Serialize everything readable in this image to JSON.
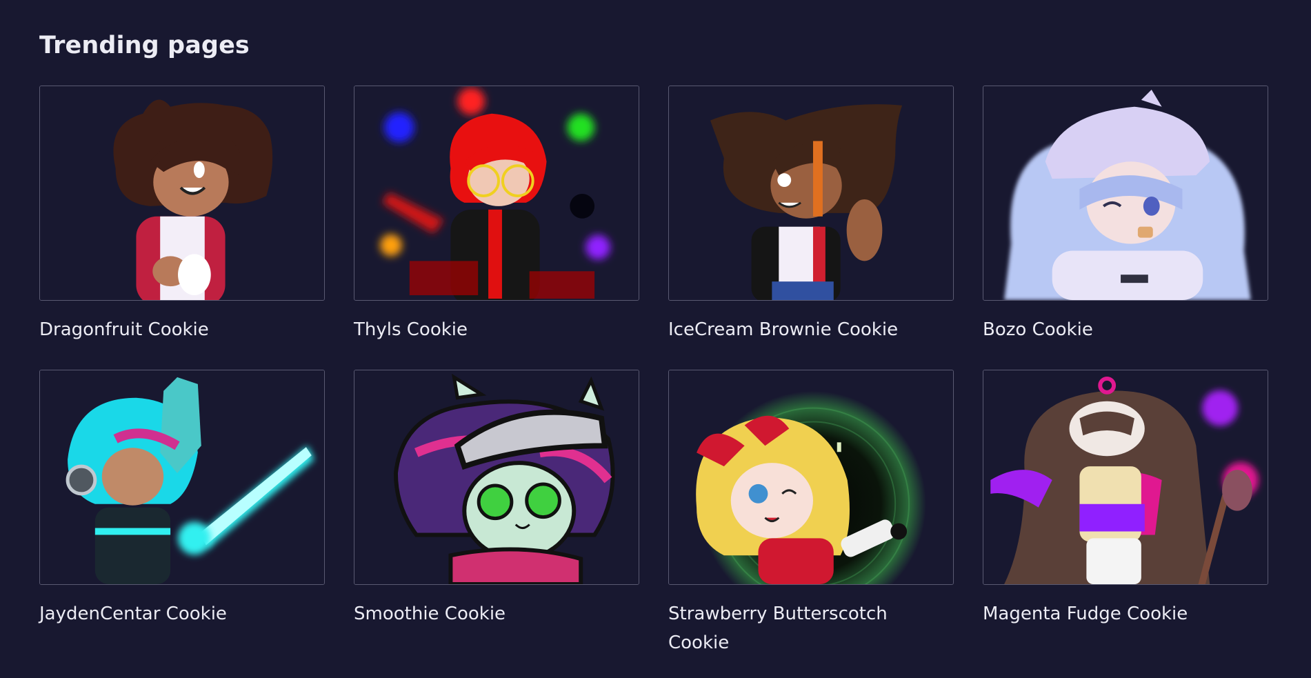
{
  "section": {
    "title": "Trending pages"
  },
  "pages": [
    {
      "label": "Dragonfruit Cookie",
      "image": "avatar-brown-hair-red-jacket"
    },
    {
      "label": "Thyls Cookie",
      "image": "avatar-red-hair-glowing-hearts"
    },
    {
      "label": "IceCream Brownie Cookie",
      "image": "avatar-brown-hair-vest"
    },
    {
      "label": "Bozo Cookie",
      "image": "avatar-lavender-beanie"
    },
    {
      "label": "JaydenCentar Cookie",
      "image": "avatar-cyan-glowing-sword"
    },
    {
      "label": "Smoothie Cookie",
      "image": "avatar-goggles-green-eyes"
    },
    {
      "label": "Strawberry Butterscotch Cookie",
      "image": "avatar-blonde-red-bow-portal"
    },
    {
      "label": "Magenta Fudge Cookie",
      "image": "avatar-brown-hair-magenta-paint"
    }
  ],
  "colors": {
    "background": "#181830",
    "card_border": "#5a5a72",
    "text": "#ececf4"
  }
}
